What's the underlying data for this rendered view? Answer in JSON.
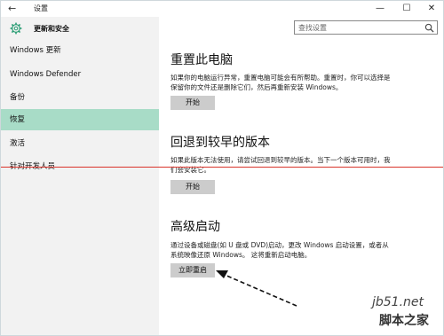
{
  "window": {
    "title": "设置",
    "back_icon": "←",
    "minimize": "—",
    "maximize": "☐",
    "close": "✕"
  },
  "sidebar": {
    "title": "更新和安全",
    "items": [
      {
        "label": "Windows 更新",
        "selected": false
      },
      {
        "label": "Windows Defender",
        "selected": false
      },
      {
        "label": "备份",
        "selected": false
      },
      {
        "label": "恢复",
        "selected": true
      },
      {
        "label": "激活",
        "selected": false
      },
      {
        "label": "针对开发人员",
        "selected": false
      }
    ]
  },
  "search": {
    "placeholder": "查找设置"
  },
  "sections": {
    "reset": {
      "heading": "重置此电脑",
      "description": "如果你的电脑运行异常，重置电脑可能会有所帮助。重置时，你可以选择是保留你的文件还是删除它们，然后再重新安装 Windows。",
      "button": "开始"
    },
    "rollback": {
      "heading": "回退到较早的版本",
      "description": "如果此版本无法使用，请尝试回退到较早的版本。当下一个版本可用时，我们会安装它。",
      "button": "开始"
    },
    "advanced": {
      "heading": "高级启动",
      "description": "通过设备或磁盘(如 U 盘或 DVD)启动，更改 Windows 启动设置，或者从系统映像还原 Windows。 这将重新启动电脑。",
      "button": "立即重启"
    }
  },
  "watermark": {
    "line1": "jb51.net",
    "line2": "脚本之家"
  },
  "colors": {
    "sidebar_bg": "#f2f2f2",
    "selected_bg": "#a8dcc7",
    "button_bg": "#cccccc",
    "accent_red": "#d9332b"
  }
}
